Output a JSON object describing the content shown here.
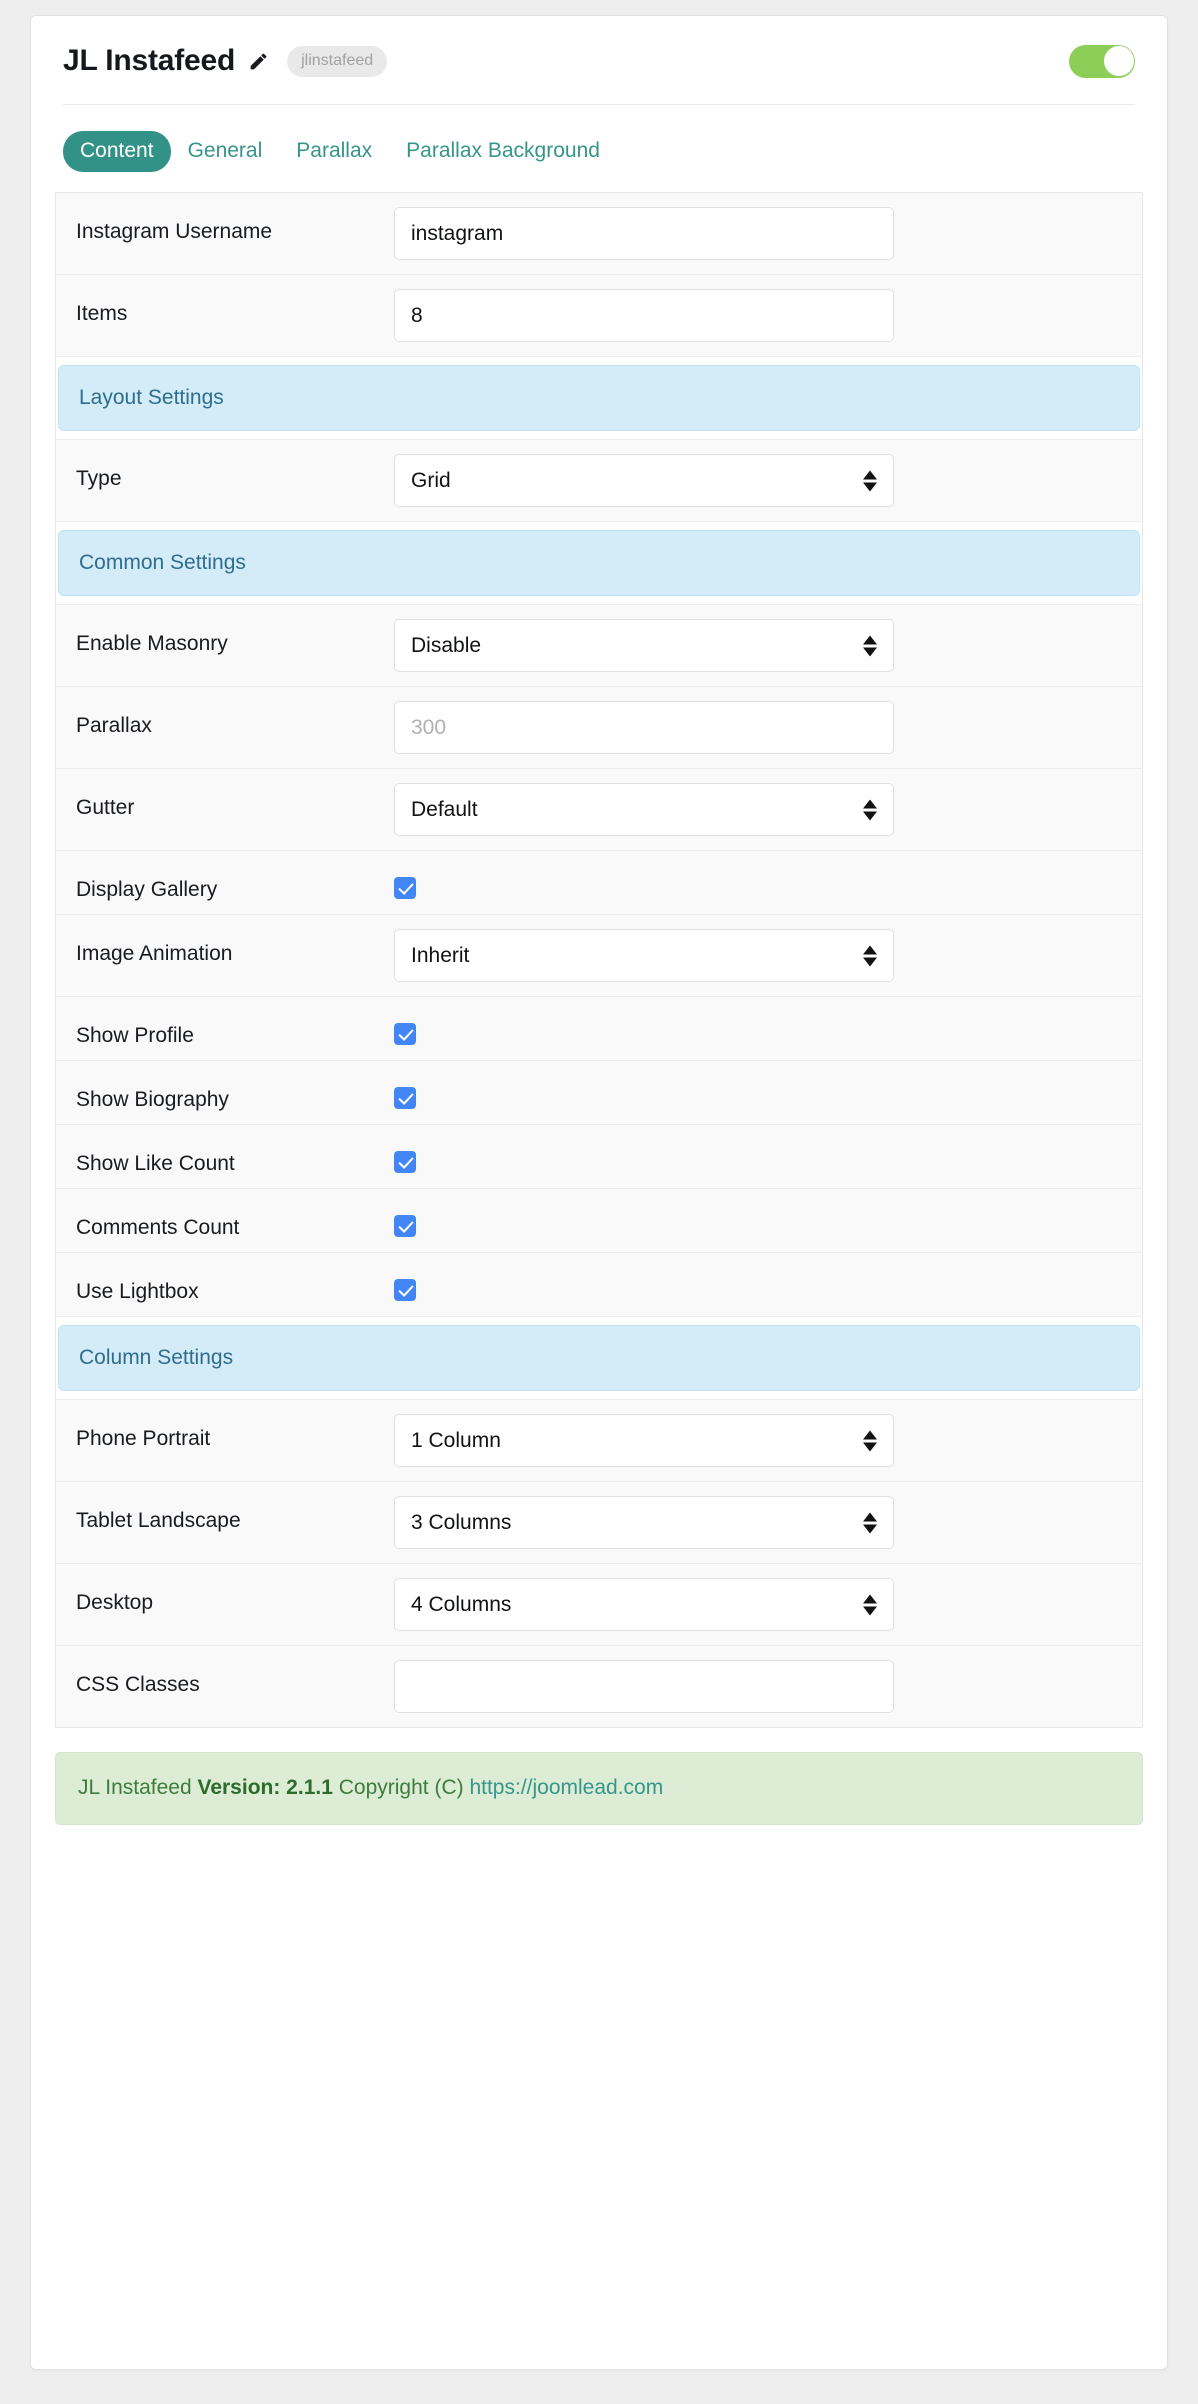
{
  "header": {
    "title": "JL Instafeed",
    "edit_icon": "pencil-icon",
    "badge": "jlinstafeed",
    "toggle_state": "on",
    "toggle_color": "#8dce59"
  },
  "tabs": [
    {
      "label": "Content",
      "active": true
    },
    {
      "label": "General",
      "active": false
    },
    {
      "label": "Parallax",
      "active": false
    },
    {
      "label": "Parallax Background",
      "active": false
    }
  ],
  "colors": {
    "accent_teal": "#339287",
    "section_bg": "#d3ecf7",
    "section_text": "#2f6d8e",
    "checkbox_blue": "#4285f4",
    "footer_bg": "#dcecd5",
    "footer_text": "#3e7c3e",
    "link": "#37968c"
  },
  "form": {
    "rows": [
      {
        "type": "text",
        "label": "Instagram Username",
        "value": "instagram",
        "placeholder": ""
      },
      {
        "type": "text",
        "label": "Items",
        "value": "8",
        "placeholder": ""
      },
      {
        "type": "section",
        "label": "Layout Settings"
      },
      {
        "type": "select",
        "label": "Type",
        "value": "Grid"
      },
      {
        "type": "section",
        "label": "Common Settings"
      },
      {
        "type": "select",
        "label": "Enable Masonry",
        "value": "Disable"
      },
      {
        "type": "text",
        "label": "Parallax",
        "value": "",
        "placeholder": "300"
      },
      {
        "type": "select",
        "label": "Gutter",
        "value": "Default"
      },
      {
        "type": "checkbox",
        "label": "Display Gallery",
        "checked": true
      },
      {
        "type": "select",
        "label": "Image Animation",
        "value": "Inherit"
      },
      {
        "type": "checkbox",
        "label": "Show Profile",
        "checked": true
      },
      {
        "type": "checkbox",
        "label": "Show Biography",
        "checked": true
      },
      {
        "type": "checkbox",
        "label": "Show Like Count",
        "checked": true
      },
      {
        "type": "checkbox",
        "label": "Comments Count",
        "checked": true
      },
      {
        "type": "checkbox",
        "label": "Use Lightbox",
        "checked": true
      },
      {
        "type": "section",
        "label": "Column Settings"
      },
      {
        "type": "select",
        "label": "Phone Portrait",
        "value": "1 Column"
      },
      {
        "type": "select",
        "label": "Tablet Landscape",
        "value": "3 Columns"
      },
      {
        "type": "select",
        "label": "Desktop",
        "value": "4 Columns"
      },
      {
        "type": "text",
        "label": "CSS Classes",
        "value": "",
        "placeholder": ""
      }
    ]
  },
  "footer": {
    "name": "JL Instafeed",
    "version_label": "Version: 2.1.1",
    "copyright": "Copyright (C)",
    "link": "https://joomlead.com"
  }
}
